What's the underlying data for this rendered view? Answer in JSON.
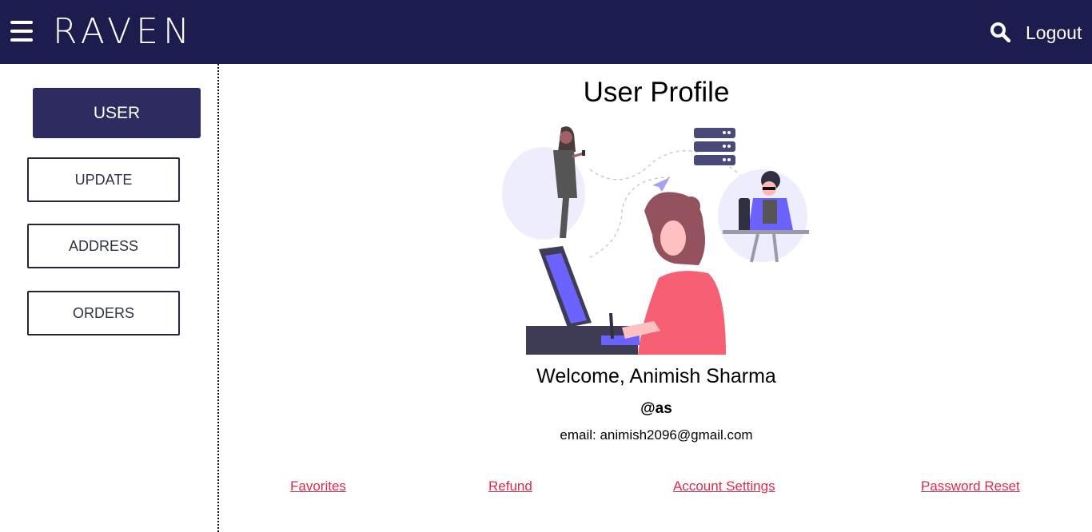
{
  "header": {
    "brand": "RAVEN",
    "logout_label": "Logout",
    "menu_icon": "hamburger-menu-icon",
    "search_icon": "search-icon",
    "background_color": "#1c1c4f"
  },
  "sidebar": {
    "active_label": "USER",
    "items": [
      {
        "label": "UPDATE"
      },
      {
        "label": "ADDRESS"
      },
      {
        "label": "ORDERS"
      }
    ]
  },
  "profile": {
    "title": "User Profile",
    "welcome": "Welcome, Animish Sharma",
    "handle": "@as",
    "email": "email: animish2096@gmail.com"
  },
  "links": {
    "favorites": "Favorites",
    "refund": "Refund",
    "account_settings": "Account Settings",
    "password_reset": "Password Reset"
  },
  "colors": {
    "accent": "#2d2b5f",
    "link": "#dc2a4d",
    "illustration_purple": "#6c63ff",
    "illustration_pink": "#f75f75"
  }
}
